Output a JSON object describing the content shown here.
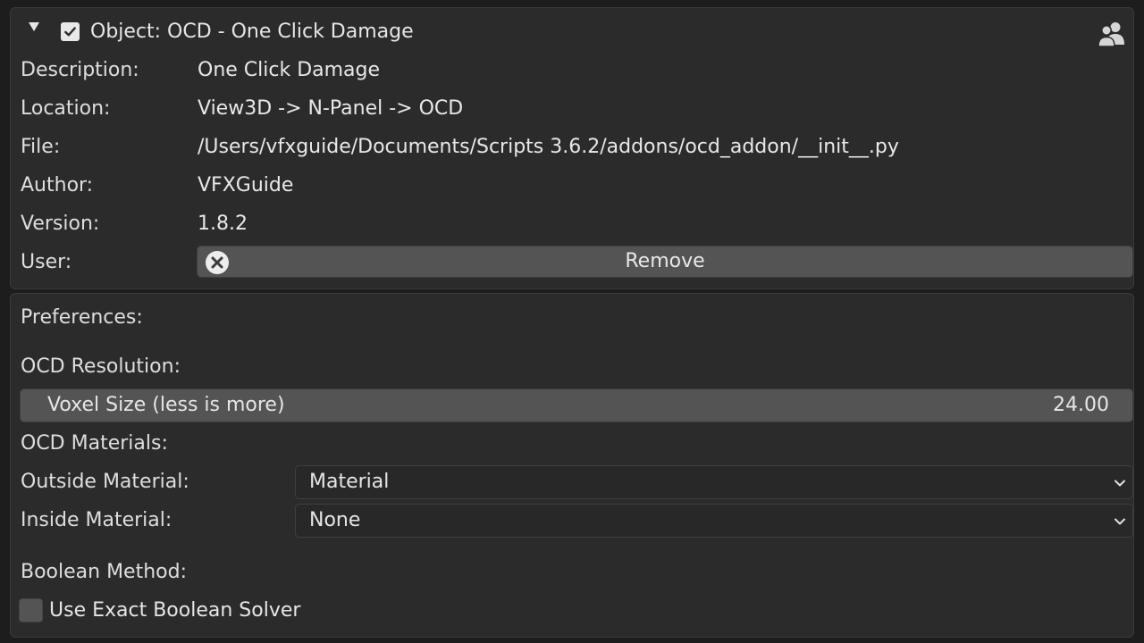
{
  "addon": {
    "header": {
      "expanded_icon": "disclosure-triangle-down-icon",
      "enabled": true,
      "title": "Object: OCD - One Click Damage",
      "users_icon": "users-icon"
    },
    "info": [
      {
        "label": "Description:",
        "value": "One Click Damage"
      },
      {
        "label": "Location:",
        "value": "View3D -> N-Panel -> OCD"
      },
      {
        "label": "File:",
        "value": "/Users/vfxguide/Documents/Scripts 3.6.2/addons/ocd_addon/__init__.py"
      },
      {
        "label": "Author:",
        "value": "VFXGuide"
      },
      {
        "label": "Version:",
        "value": "1.8.2"
      }
    ],
    "user": {
      "label": "User:",
      "remove_button": "Remove",
      "remove_icon": "cancel-x-icon"
    }
  },
  "preferences": {
    "title": "Preferences:",
    "resolution": {
      "heading": "OCD Resolution:",
      "slider_label": "Voxel Size (less is more)",
      "slider_value": "24.00"
    },
    "materials": {
      "heading": "OCD Materials:",
      "outside_label": "Outside Material:",
      "outside_value": "Material",
      "inside_label": "Inside Material:",
      "inside_value": "None"
    },
    "boolean": {
      "heading": "Boolean Method:",
      "exact_solver_label": "Use Exact Boolean Solver",
      "exact_solver_checked": false
    }
  },
  "colors": {
    "background": "#1d1d1d",
    "panel": "#2b2b2b",
    "button": "#545454",
    "text": "#e6e6e6"
  }
}
